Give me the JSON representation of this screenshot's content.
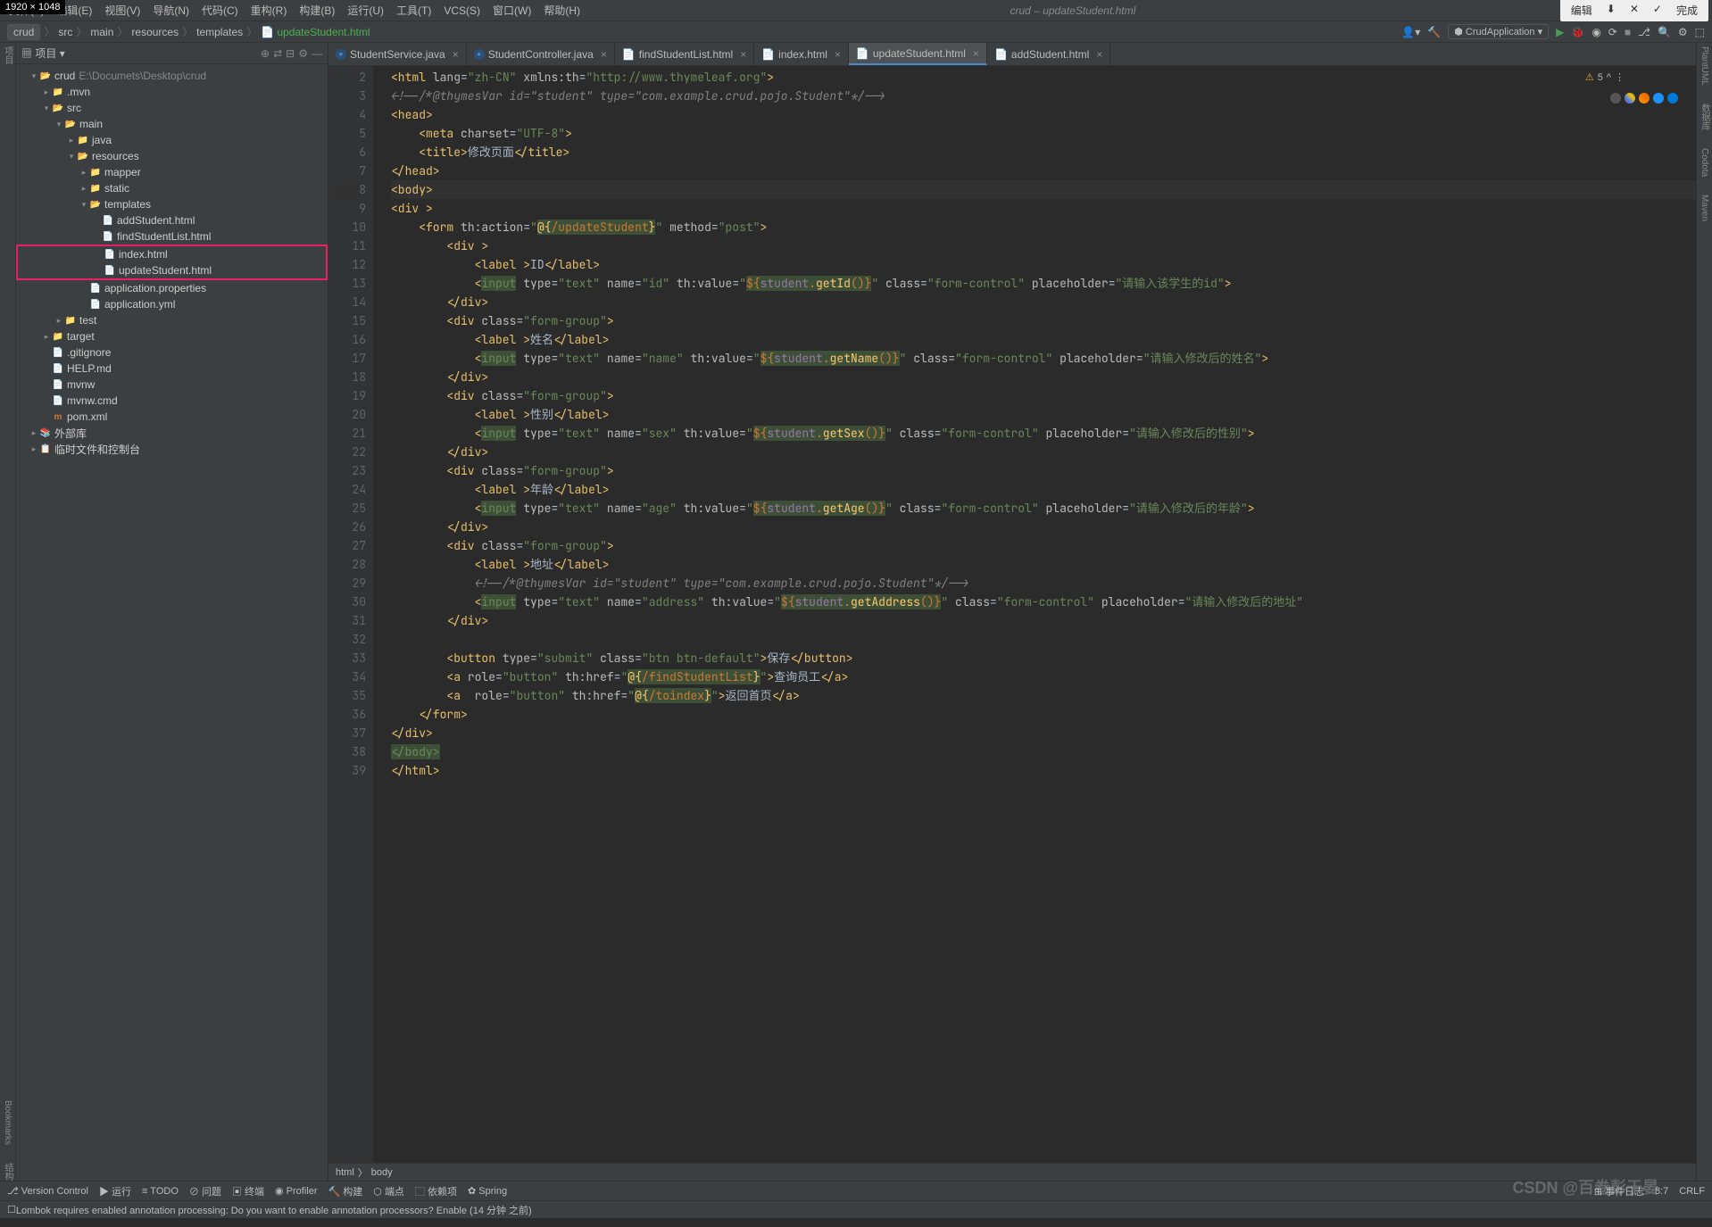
{
  "dimensions": "1920 × 1048",
  "menu": {
    "file": "文件(F)",
    "edit": "编辑(E)",
    "view": "视图(V)",
    "navigate": "导航(N)",
    "code": "代码(C)",
    "refactor": "重构(R)",
    "build": "构建(B)",
    "run": "运行(U)",
    "tools": "工具(T)",
    "vcs": "VCS(S)",
    "window": "窗口(W)",
    "help": "帮助(H)",
    "title": "crud – updateStudent.html",
    "right_edit": "编辑",
    "right_done": "完成"
  },
  "breadcrumbs": [
    "crud",
    "src",
    "main",
    "resources",
    "templates",
    "updateStudent.html"
  ],
  "run_config": "CrudApplication",
  "project": {
    "title": "项目",
    "root": "crud",
    "root_path": "E:\\Documets\\Desktop\\crud",
    "items": [
      {
        "d": 1,
        "t": "folder-open",
        "a": "v",
        "l": "crud",
        "p": "E:\\Documets\\Desktop\\crud"
      },
      {
        "d": 2,
        "t": "folder",
        "a": ">",
        "l": ".mvn"
      },
      {
        "d": 2,
        "t": "folder-open",
        "a": "v",
        "l": "src"
      },
      {
        "d": 3,
        "t": "folder-open",
        "a": "v",
        "l": "main"
      },
      {
        "d": 4,
        "t": "folder",
        "a": ">",
        "l": "java"
      },
      {
        "d": 4,
        "t": "folder-open",
        "a": "v",
        "l": "resources"
      },
      {
        "d": 5,
        "t": "folder",
        "a": ">",
        "l": "mapper"
      },
      {
        "d": 5,
        "t": "folder",
        "a": ">",
        "l": "static"
      },
      {
        "d": 5,
        "t": "folder-open",
        "a": "v",
        "l": "templates"
      },
      {
        "d": 6,
        "t": "html",
        "a": "",
        "l": "addStudent.html"
      },
      {
        "d": 6,
        "t": "html",
        "a": "",
        "l": "findStudentList.html"
      },
      {
        "d": 6,
        "t": "html",
        "a": "",
        "l": "index.html",
        "hl": true
      },
      {
        "d": 6,
        "t": "html",
        "a": "",
        "l": "updateStudent.html",
        "hl": true
      },
      {
        "d": 5,
        "t": "file",
        "a": "",
        "l": "application.properties"
      },
      {
        "d": 5,
        "t": "file",
        "a": "",
        "l": "application.yml"
      },
      {
        "d": 3,
        "t": "folder",
        "a": ">",
        "l": "test"
      },
      {
        "d": 2,
        "t": "folder",
        "a": ">",
        "l": "target"
      },
      {
        "d": 2,
        "t": "file",
        "a": "",
        "l": ".gitignore"
      },
      {
        "d": 2,
        "t": "file",
        "a": "",
        "l": "HELP.md"
      },
      {
        "d": 2,
        "t": "file",
        "a": "",
        "l": "mvnw"
      },
      {
        "d": 2,
        "t": "file",
        "a": "",
        "l": "mvnw.cmd"
      },
      {
        "d": 2,
        "t": "file",
        "a": "",
        "l": "pom.xml",
        "icon": "m"
      },
      {
        "d": 1,
        "t": "lib",
        "a": ">",
        "l": "外部库"
      },
      {
        "d": 1,
        "t": "scratch",
        "a": ">",
        "l": "临时文件和控制台"
      }
    ]
  },
  "tabs": [
    {
      "icon": "J",
      "label": "StudentService.java"
    },
    {
      "icon": "J",
      "label": "StudentController.java"
    },
    {
      "icon": "H",
      "label": "findStudentList.html"
    },
    {
      "icon": "H",
      "label": "index.html"
    },
    {
      "icon": "H",
      "label": "updateStudent.html",
      "active": true
    },
    {
      "icon": "H",
      "label": "addStudent.html"
    }
  ],
  "analysis": {
    "warn": "5",
    "up": "^"
  },
  "code_lines_start": 2,
  "code_lines_end": 39,
  "bottom_crumbs": [
    "html",
    "body"
  ],
  "status": {
    "vc": "Version Control",
    "run": "运行",
    "todo": "TODO",
    "problems": "问题",
    "terminal": "终端",
    "profiler": "Profiler",
    "build": "构建",
    "endpoints": "端点",
    "deps": "依赖项",
    "spring": "Spring",
    "events": "事件日志",
    "pos": "8:7",
    "crlf": "CRLF",
    "notification": "Lombok requires enabled annotation processing: Do you want to enable annotation processors? Enable (14 分钟 之前)"
  },
  "watermark": "CSDN @百卷彭于晏",
  "right_tools": [
    "PlantUML",
    "数据库",
    "Codota",
    "Maven"
  ],
  "left_tools": [
    "项目",
    "Bookmarks",
    "结构"
  ]
}
